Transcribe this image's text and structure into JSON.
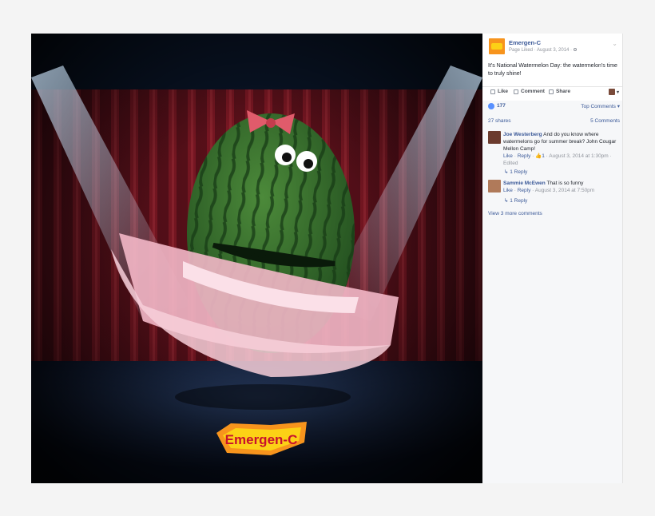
{
  "post": {
    "page_name": "Emergen-C",
    "meta": "Page Liked · August 3, 2014 ·",
    "text": "It's National Watermelon Day: the watermelon's time to truly shine!",
    "brand_logo_text": "Emergen-C"
  },
  "actions": {
    "like": "Like",
    "comment": "Comment",
    "share": "Share"
  },
  "stats": {
    "likes": "177",
    "sort": "Top Comments",
    "shares": "27 shares",
    "comments": "5 Comments"
  },
  "comments": [
    {
      "name": "Joe Westerberg",
      "text": "And do you know where watermelons go for summer break? John Cougar Mellon Camp!",
      "like": "Like",
      "reply": "Reply",
      "reaction_count": "1",
      "timestamp": "August 3, 2014 at 1:30pm",
      "edited": "Edited",
      "replies": "1 Reply"
    },
    {
      "name": "Sammie McEwen",
      "text": "That is so funny",
      "like": "Like",
      "reply": "Reply",
      "timestamp": "August 3, 2014 at 7:50pm",
      "replies": "1 Reply"
    }
  ],
  "view_more": "View 3 more comments",
  "colors": {
    "link": "#3b5998",
    "meta": "#90949c",
    "brand_orange": "#f7941d",
    "brand_yellow": "#fcd116"
  }
}
